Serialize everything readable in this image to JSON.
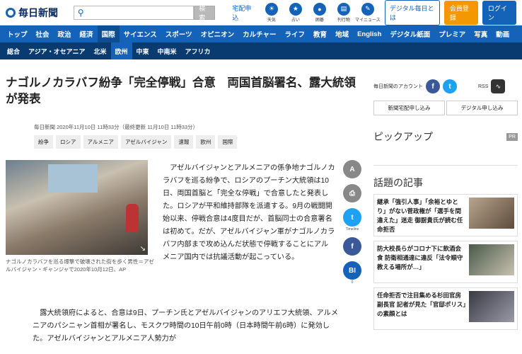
{
  "header": {
    "logo_text": "毎日新聞",
    "search_placeholder": "",
    "search_button": "検索",
    "delivery_link": "宅配申込",
    "icons": [
      {
        "label": "天気",
        "glyph": "☀",
        "icon": "weather-icon"
      },
      {
        "label": "占い",
        "glyph": "★",
        "icon": "fortune-icon"
      },
      {
        "label": "囲碁",
        "glyph": "●",
        "icon": "go-icon"
      },
      {
        "label": "刊行物",
        "glyph": "▤",
        "icon": "publications-icon"
      },
      {
        "label": "マイニュース",
        "glyph": "✎",
        "icon": "mynews-icon"
      }
    ],
    "digital_button": "デジタル毎日とは",
    "member_button": "会員登録",
    "login_button": "ログイン"
  },
  "nav": [
    "トップ",
    "社会",
    "政治",
    "経済",
    "国際",
    "サイエンス",
    "スポーツ",
    "オピニオン",
    "カルチャー",
    "ライフ",
    "教育",
    "地域",
    "English",
    "デジタル紙面",
    "プレミア",
    "写真",
    "動画"
  ],
  "nav_active": 4,
  "subnav": [
    "総合",
    "アジア・オセアニア",
    "北米",
    "欧州",
    "中東",
    "中南米",
    "アフリカ"
  ],
  "subnav_active": 3,
  "article": {
    "title": "ナゴルノカラバフ紛争「完全停戦」合意　両国首脳署名、露大統領が発表",
    "dateline": "毎日新聞 2020年11月10日 11時33分（最終更新 11月10日 11時33分）",
    "tags": [
      "紛争",
      "ロシア",
      "アルメニア",
      "アゼルバイジャン",
      "速報",
      "欧州",
      "国際"
    ],
    "caption": "ナゴルノカラバフを巡る爆撃で破壊された街を歩く男性＝アゼルバイジャン・ギャンジャで2020年10月12日、AP",
    "lead": "アゼルバイジャンとアルメニアの係争地ナゴルノカラバフを巡る紛争で、ロシアのプーチン大統領は10日、両国首脳と「完全な停戦」で合意したと発表した。ロシアが平和維持部隊を派遣する。9月の戦闘開始以来、停戦合意は4度目だが、首脳同士の合意署名は初めて。だが、アゼルバイジャン軍がナゴルノカラバフ内部まで攻め込んだ状態で停戦することにアルメニア国内では抗議活動が起こっている。",
    "body2": "露大統領府によると、合意は9日、プーチン氏とアゼルバイジャンのアリエフ大統領、アルメニアのパシニャン首相が署名し、モスクワ時間の10日午前0時（日本時間午前6時）に発効した。アゼルバイジャンとアルメニア人勢力が"
  },
  "share": [
    {
      "glyph": "A",
      "label": "",
      "color": "#888888",
      "icon": "font-size-icon"
    },
    {
      "glyph": "⎙",
      "label": "",
      "color": "#888888",
      "icon": "print-icon"
    },
    {
      "glyph": "t",
      "label": "Timeline",
      "color": "#1da1f2",
      "icon": "twitter-icon"
    },
    {
      "glyph": "f",
      "label": "",
      "color": "#3b5998",
      "icon": "facebook-icon"
    },
    {
      "glyph": "BI",
      "label": "0",
      "color": "#1463b8",
      "icon": "hatena-icon"
    }
  ],
  "sidebar": {
    "account_label": "毎日新聞のアカウント",
    "rss_label": "RSS",
    "delivery_button": "新聞宅配申し込み",
    "digital_button": "デジタル申し込み",
    "pickup_heading": "ピックアップ",
    "pr_badge": "PR",
    "topic_heading": "話題の記事",
    "news": [
      {
        "text": "継承「強引人事」「余裕とゆとり」がない菅政権が「選手を間違えた」迷走 御厨貴氏が読む任命拒否"
      },
      {
        "text": "防大校長らがコロナ下に飲酒会食 防衛相通達に違反「法令順守教える場所が…」"
      },
      {
        "text": "任命拒否で注目集める杉田官房副長官 記者が見た「官邸ポリス」の素顔とは"
      }
    ]
  }
}
